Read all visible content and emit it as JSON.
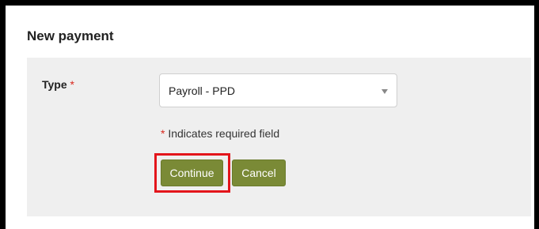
{
  "form": {
    "title": "New payment",
    "type_label": "Type",
    "required_marker": "*",
    "type_select": {
      "selected": "Payroll - PPD"
    },
    "required_note_marker": "*",
    "required_note": "Indicates required field",
    "continue_label": "Continue",
    "cancel_label": "Cancel"
  },
  "colors": {
    "button_bg": "#7a8a36",
    "required_red": "#d9281e",
    "highlight_red": "#e3151b",
    "panel_bg": "#efefef"
  },
  "icons": {
    "select_caret": "chevron-down-icon"
  }
}
